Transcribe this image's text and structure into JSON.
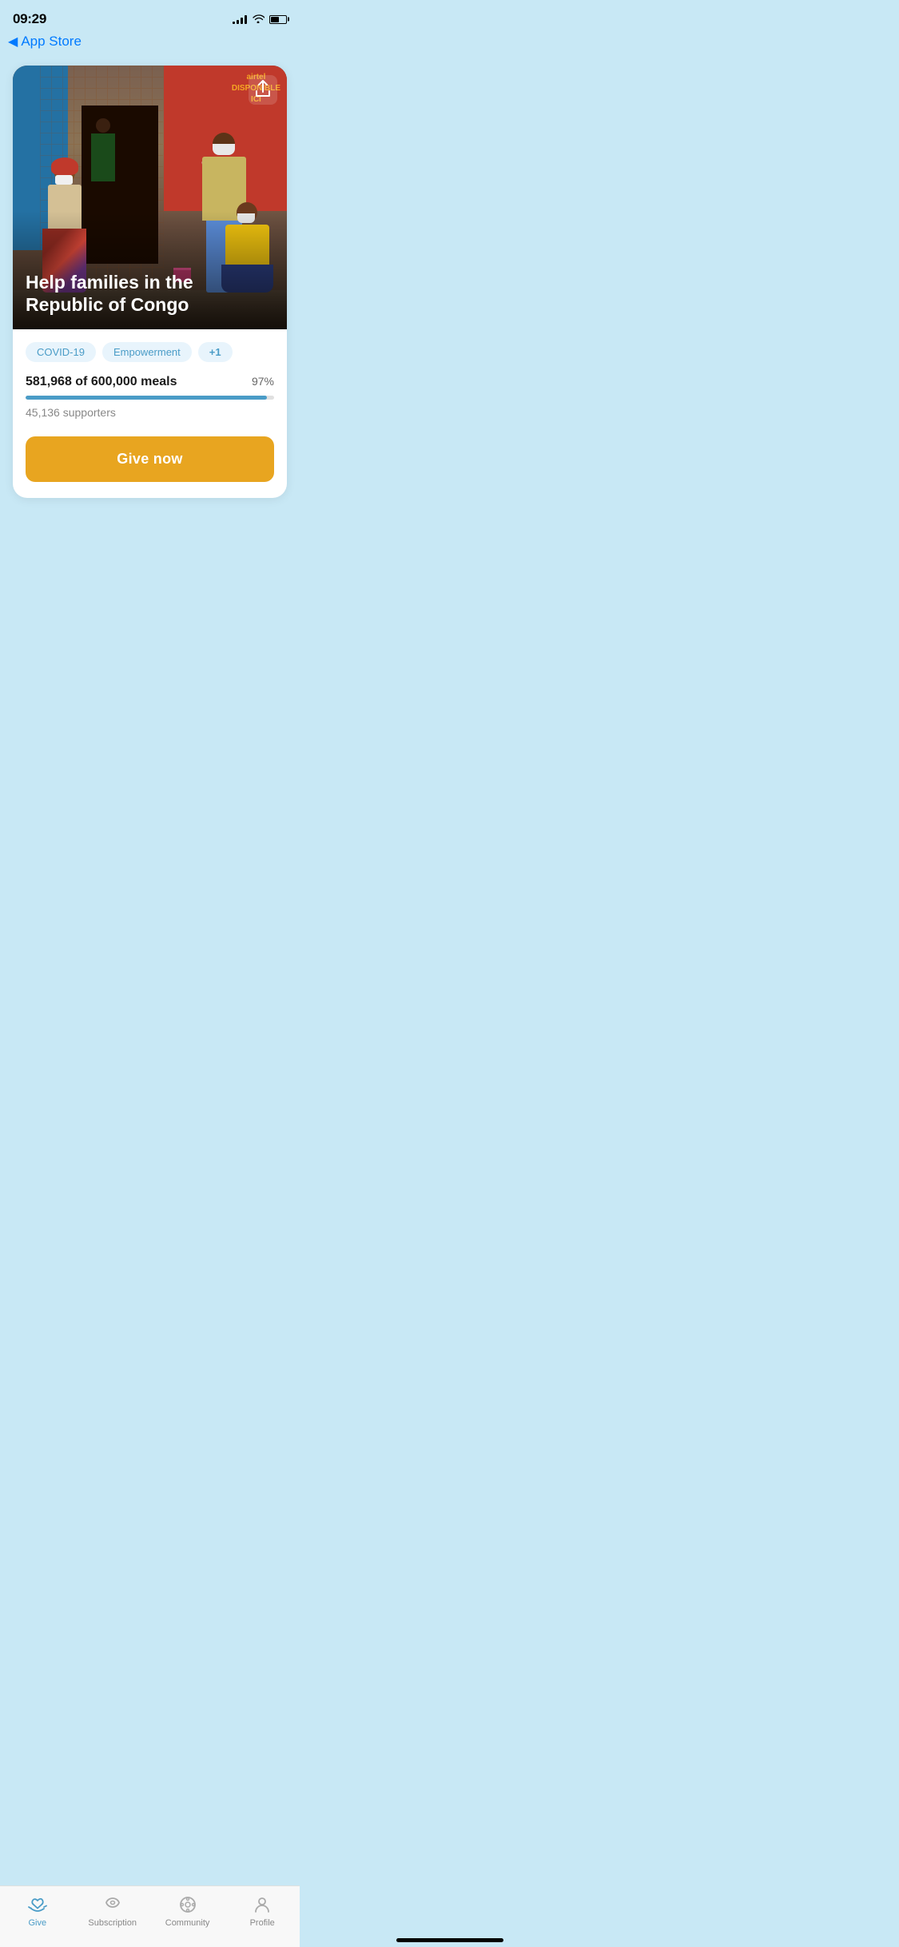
{
  "status": {
    "time": "09:29",
    "signal_bars": [
      3,
      5,
      7,
      9,
      11
    ],
    "battery_level": 55
  },
  "nav": {
    "back_label": "App Store"
  },
  "campaign": {
    "title": "Help families in the\nRepublic of Congo",
    "tags": [
      "COVID-19",
      "Empowerment",
      "+1"
    ],
    "progress": {
      "current": "581,968",
      "goal": "600,000",
      "unit": "meals",
      "display_text": "581,968 of 600,000 meals",
      "percent": 97,
      "percent_label": "97%",
      "fill_width": "97%",
      "supporters": "45,136 supporters"
    },
    "cta_button": "Give now"
  },
  "bottom_nav": {
    "items": [
      {
        "id": "give",
        "label": "Give",
        "active": true
      },
      {
        "id": "subscription",
        "label": "Subscription",
        "active": false
      },
      {
        "id": "community",
        "label": "Community",
        "active": false
      },
      {
        "id": "profile",
        "label": "Profile",
        "active": false
      }
    ]
  },
  "image": {
    "airtel_text": "airtel\nDISPONIBLE\nICI"
  }
}
